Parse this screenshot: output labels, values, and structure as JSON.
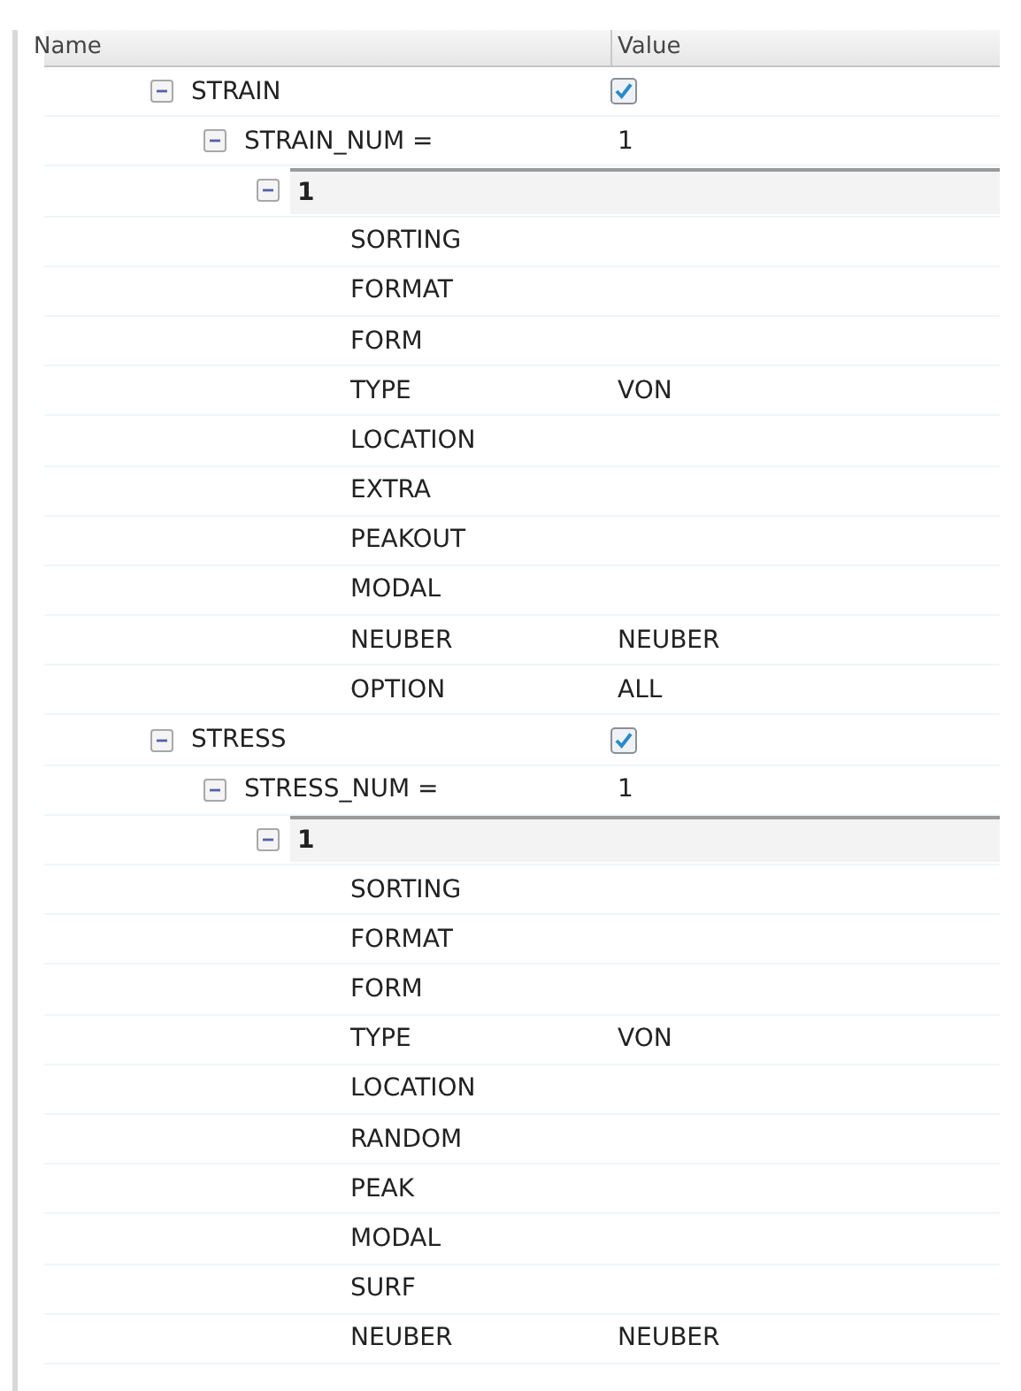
{
  "columns": [
    "Name",
    "Value"
  ],
  "tree": [
    {
      "label": "STRAIN",
      "kind": "section",
      "expanded": true,
      "checked": true,
      "children": [
        {
          "label": "STRAIN_NUM =",
          "kind": "count",
          "expanded": true,
          "value": "1",
          "children": [
            {
              "label": "1",
              "kind": "group",
              "expanded": true,
              "children": [
                {
                  "label": "SORTING",
                  "kind": "leaf"
                },
                {
                  "label": "FORMAT",
                  "kind": "leaf"
                },
                {
                  "label": "FORM",
                  "kind": "leaf"
                },
                {
                  "label": "TYPE",
                  "kind": "leaf",
                  "value": "VON"
                },
                {
                  "label": "LOCATION",
                  "kind": "leaf"
                },
                {
                  "label": "EXTRA",
                  "kind": "leaf"
                },
                {
                  "label": "PEAKOUT",
                  "kind": "leaf"
                },
                {
                  "label": "MODAL",
                  "kind": "leaf"
                },
                {
                  "label": "NEUBER",
                  "kind": "leaf",
                  "value": "NEUBER"
                },
                {
                  "label": "OPTION",
                  "kind": "leaf",
                  "value": "ALL"
                }
              ]
            }
          ]
        }
      ]
    },
    {
      "label": "STRESS",
      "kind": "section",
      "expanded": true,
      "checked": true,
      "children": [
        {
          "label": "STRESS_NUM =",
          "kind": "count",
          "expanded": true,
          "value": "1",
          "children": [
            {
              "label": "1",
              "kind": "group",
              "expanded": true,
              "children": [
                {
                  "label": "SORTING",
                  "kind": "leaf"
                },
                {
                  "label": "FORMAT",
                  "kind": "leaf"
                },
                {
                  "label": "FORM",
                  "kind": "leaf"
                },
                {
                  "label": "TYPE",
                  "kind": "leaf",
                  "value": "VON"
                },
                {
                  "label": "LOCATION",
                  "kind": "leaf"
                },
                {
                  "label": "RANDOM",
                  "kind": "leaf"
                },
                {
                  "label": "PEAK",
                  "kind": "leaf"
                },
                {
                  "label": "MODAL",
                  "kind": "leaf"
                },
                {
                  "label": "SURF",
                  "kind": "leaf"
                },
                {
                  "label": "NEUBER",
                  "kind": "leaf",
                  "value": "NEUBER"
                }
              ]
            }
          ]
        }
      ]
    }
  ]
}
